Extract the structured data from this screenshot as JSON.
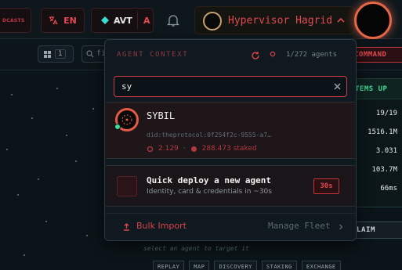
{
  "topbar": {
    "casts_label": "DCASTS",
    "lang": {
      "icon": "translate-icon",
      "label": "EN"
    },
    "avt": {
      "icon": "diamond-icon",
      "label": "AVT",
      "letter": "A",
      "diamond_color": "#3ddcd0"
    },
    "bell_icon": "bell-icon",
    "user": {
      "name": "Hypervisor Hagrid",
      "caret_icon": "chevron-up-icon"
    },
    "accent_color": "#e04a50"
  },
  "toolbar": {
    "grid_icon": "grid-icon",
    "grid_count": "1",
    "find_placeholder": "fi",
    "command_label": "COMMAND"
  },
  "stats_panel": {
    "header": "TEMS UP",
    "values": [
      "19/19",
      "1516.1M",
      "3.031",
      "103.7M",
      "66ms"
    ],
    "claim_label": "LAIM"
  },
  "hint": "select an agent to target it",
  "bottom_tabs": [
    "REPLAY",
    "MAP",
    "DISCOVERY",
    "STAKING",
    "EXCHANGE"
  ],
  "dropdown": {
    "title": "AGENT CONTEXT",
    "refresh_icon": "refresh-icon",
    "agent_icon": "agent-icon",
    "count_label": "1/272 agents",
    "search": {
      "value": "sy",
      "clear_icon": "close-icon"
    },
    "results": [
      {
        "name": "SYBIL",
        "did": "did:theprotocol:0f254f2c-9555-a7…",
        "stat1": "2.129",
        "stat2": "288.473 staked",
        "online": true
      }
    ],
    "deploy": {
      "title": "Quick deploy a new agent",
      "subtitle": "Identity, card & credentials in ~30s",
      "badge": "30s"
    },
    "footer": {
      "bulk_import": "Bulk Import",
      "manage_fleet": "Manage Fleet",
      "manage_chevron": "chevron-right-icon"
    }
  }
}
